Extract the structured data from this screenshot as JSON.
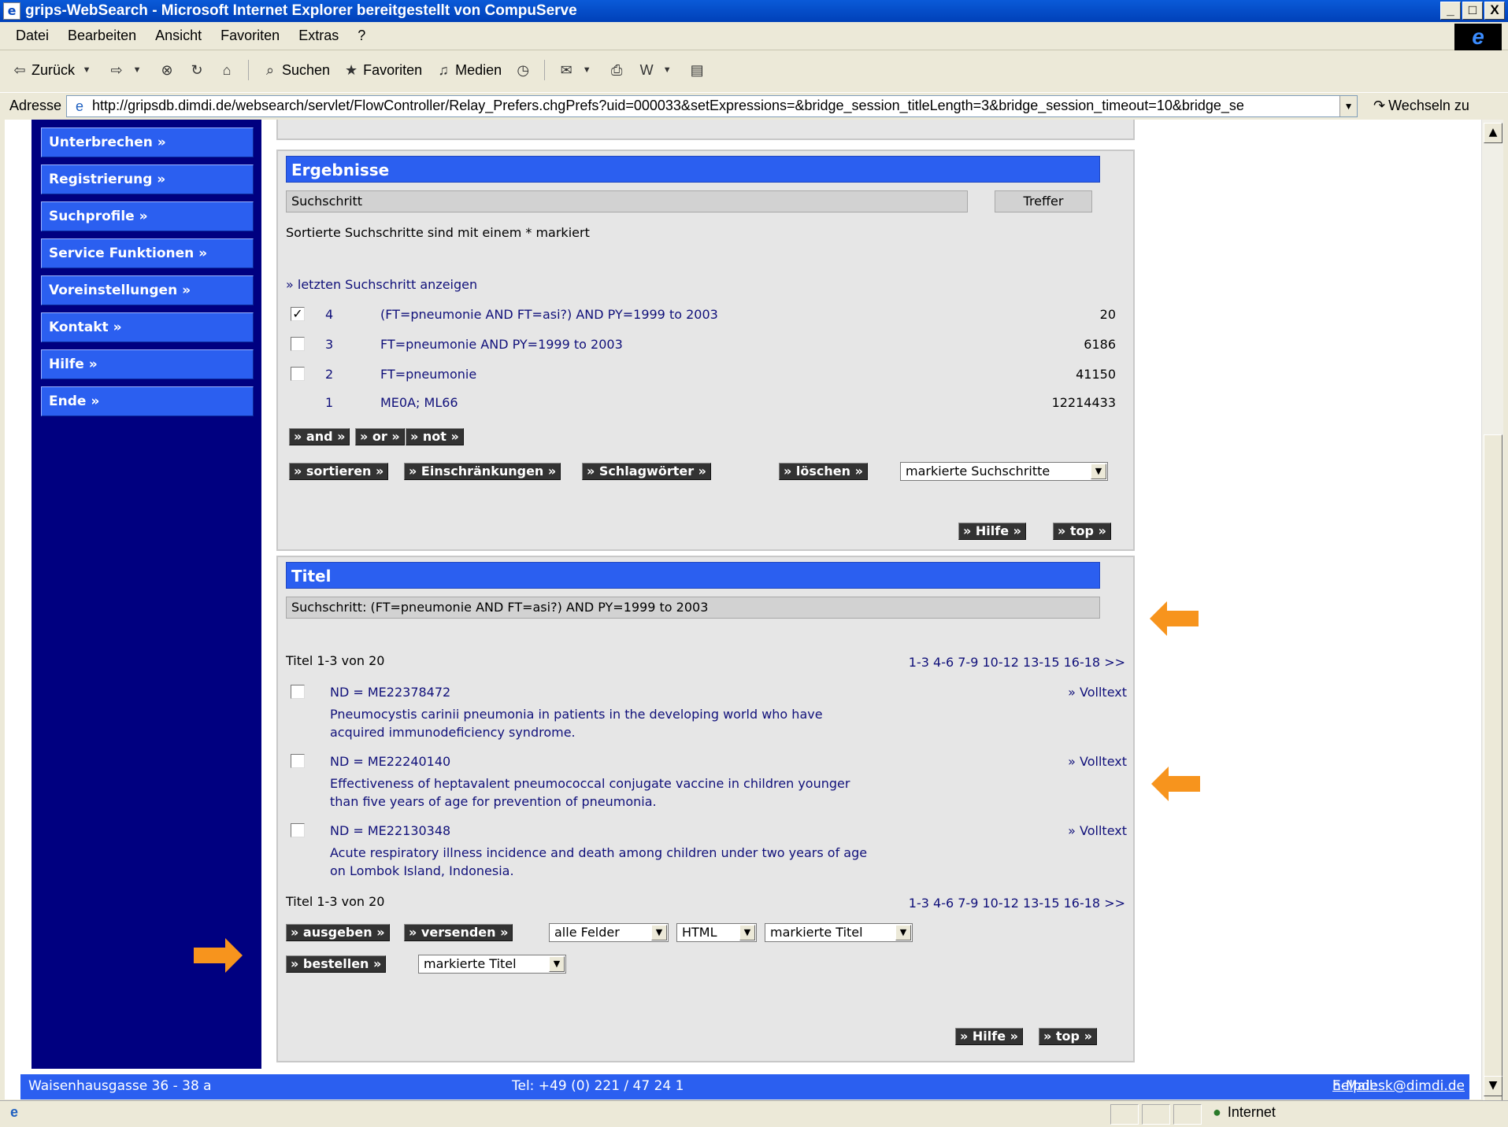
{
  "window": {
    "title": "grips-WebSearch - Microsoft Internet Explorer bereitgestellt von CompuServe",
    "controls": [
      "_",
      "□",
      "X"
    ]
  },
  "menu": [
    "Datei",
    "Bearbeiten",
    "Ansicht",
    "Favoriten",
    "Extras",
    "?"
  ],
  "toolbar": {
    "back": "Zurück",
    "search": "Suchen",
    "favorites": "Favoriten",
    "media": "Medien"
  },
  "address": {
    "label": "Adresse",
    "url": "http://gripsdb.dimdi.de/websearch/servlet/FlowController/Relay_Prefers.chgPrefs?uid=000033&setExpressions=&bridge_session_titleLength=3&bridge_session_timeout=10&bridge_se",
    "go": "Wechseln zu"
  },
  "nav": [
    "Unterbrechen »",
    "Registrierung »",
    "Suchprofile »",
    "Service Funktionen »",
    "Voreinstellungen »",
    "Kontakt »",
    "Hilfe »",
    "Ende »"
  ],
  "ergebnisse": {
    "header": "Ergebnisse",
    "col_step": "Suchschritt",
    "col_hits": "Treffer",
    "sorted_note": "Sortierte Suchschritte sind mit einem * markiert",
    "show_last": "» letzten Suchschritt anzeigen",
    "rows": [
      {
        "num": "4",
        "query": "(FT=pneumonie AND FT=asi?) AND PY=1999 to 2003",
        "hits": "20",
        "checked": true
      },
      {
        "num": "3",
        "query": "FT=pneumonie AND PY=1999 to 2003",
        "hits": "6186",
        "checked": false
      },
      {
        "num": "2",
        "query": "FT=pneumonie",
        "hits": "41150",
        "checked": false
      },
      {
        "num": "1",
        "query": "ME0A; ML66",
        "hits": "12214433",
        "checked": null
      }
    ],
    "btn_and": "» and »",
    "btn_or": "» or »",
    "btn_not": "» not »",
    "btn_sort": "» sortieren »",
    "btn_restrict": "» Einschränkungen »",
    "btn_keywords": "» Schlagwörter »",
    "btn_delete": "» löschen »",
    "delete_select": "markierte Suchschritte",
    "btn_help": "» Hilfe »",
    "btn_top": "» top »"
  },
  "titel": {
    "header": "Titel",
    "step": "Suchschritt:  (FT=pneumonie AND FT=asi?) AND PY=1999 to 2003",
    "range_label": "Titel 1-3 von 20",
    "pages": "1-3 4-6 7-9 10-12 13-15 16-18 >>",
    "items": [
      {
        "nd": "ND = ME22378472",
        "line1": "Pneumocystis carinii pneumonia in patients in the developing world who have",
        "line2": "acquired immunodeficiency syndrome.",
        "fulltext": "» Volltext"
      },
      {
        "nd": "ND = ME22240140",
        "line1": "Effectiveness of heptavalent pneumococcal conjugate vaccine in children younger",
        "line2": "than five years of age for prevention of pneumonia.",
        "fulltext": "» Volltext"
      },
      {
        "nd": "ND = ME22130348",
        "line1": "Acute respiratory illness incidence and death among children under two years of age",
        "line2": "on Lombok Island, Indonesia.",
        "fulltext": "» Volltext"
      }
    ],
    "btn_output": "» ausgeben »",
    "btn_send": "» versenden »",
    "sel_fields": "alle Felder",
    "sel_format": "HTML",
    "sel_marked1": "markierte Titel",
    "btn_order": "» bestellen »",
    "sel_marked2": "markierte Titel",
    "btn_help": "» Hilfe »",
    "btn_top": "» top »"
  },
  "footer": {
    "address": "Waisenhausgasse 36 - 38 a",
    "phone": "Tel: +49 (0) 221 / 47 24 1",
    "email_label": "E-Mail:",
    "email": "helpdesk@dimdi.de"
  },
  "status": {
    "zone": "Internet"
  },
  "colors": {
    "nav_bg": "#000080",
    "nav_button": "#2b5ff0",
    "panel_header": "#2b5ff0",
    "arrow": "#f7941d",
    "link": "#10107a"
  }
}
